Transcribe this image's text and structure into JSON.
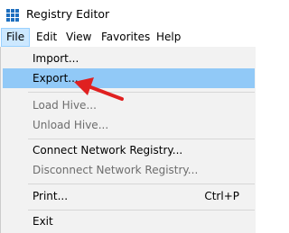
{
  "window": {
    "title": "Registry Editor",
    "icon": "registry-editor-icon"
  },
  "menubar": {
    "items": [
      "File",
      "Edit",
      "View",
      "Favorites",
      "Help"
    ],
    "active": "File"
  },
  "file_menu": {
    "import": "Import...",
    "export": "Export...",
    "load_hive": "Load Hive...",
    "unload_hive": "Unload Hive...",
    "connect": "Connect Network Registry...",
    "disconnect": "Disconnect Network Registry...",
    "print": "Print...",
    "print_shortcut": "Ctrl+P",
    "exit": "Exit"
  },
  "colors": {
    "highlight": "#91c9f7",
    "arrow": "#e02020",
    "disabled_text": "#6d6d6d"
  }
}
